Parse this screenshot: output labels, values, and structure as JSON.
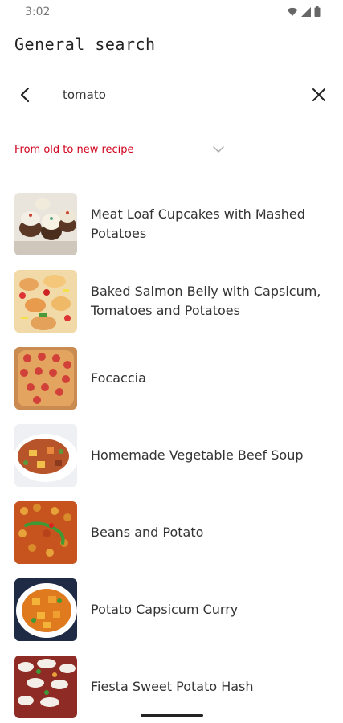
{
  "status_bar": {
    "time": "3:02",
    "icons": [
      "wifi-icon",
      "cellular-signal-icon",
      "battery-icon"
    ]
  },
  "header": {
    "title": "General search"
  },
  "search": {
    "query": "tomato",
    "back_icon": "back-arrow-icon",
    "clear_icon": "close-icon"
  },
  "sort": {
    "selected": "From old to new recipe",
    "chevron_icon": "chevron-down-icon",
    "accent_color": "#d0021b"
  },
  "recipes": [
    {
      "title": "Meat Loaf Cupcakes with Mashed Potatoes"
    },
    {
      "title": "Baked Salmon Belly with Capsicum, Tomatoes and Potatoes"
    },
    {
      "title": "Focaccia"
    },
    {
      "title": "Homemade Vegetable Beef Soup"
    },
    {
      "title": "Beans and Potato"
    },
    {
      "title": "Potato Capsicum Curry"
    },
    {
      "title": "Fiesta Sweet Potato Hash"
    }
  ]
}
